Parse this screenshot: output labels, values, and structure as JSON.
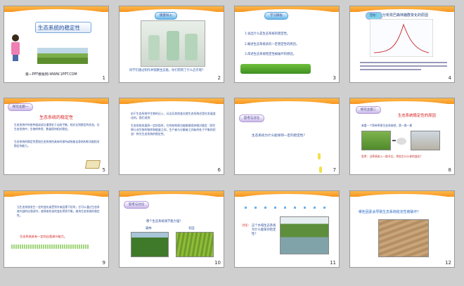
{
  "slides": [
    {
      "num": "1",
      "title": "生态系统的稳定性",
      "footer": "第一PPT模板网-WWW.1PPT.COM"
    },
    {
      "num": "2",
      "badge": "情景导入",
      "question": "同学们通过制作并观察生态瓶，你们得到了什么启示呢？"
    },
    {
      "num": "3",
      "badge": "学习目标",
      "items": [
        "1.说出什么是生态系统的稳定性。",
        "2.概述生态系统具有一定稳定性的原因。",
        "3.简述生态系统稳定性被破坏的原因。"
      ]
    },
    {
      "num": "4",
      "badge": "活动：",
      "title": "分析凯巴森林鹿群变化的原因"
    },
    {
      "num": "5",
      "badge": "探究主题一",
      "heading": "生态系统的稳定性",
      "para": "生态系统中的各种组成成分通常处于动态平衡，相对达到稳定的状态。在生态系统中，生物的种类、数量保持相对稳定。",
      "para2": "生态系统的稳定性是指生态系统所具有的保持或恢复自身结构和功能相对稳定的能力。"
    },
    {
      "num": "6",
      "para": "由于生态系统中生物的迁入、迁出及其他变化使生态系统总是在发展变化的。我们说到：",
      "para2": "生态系统发展到一定阶段时，它的结构和功能能够保持相对稳定（即生物与非生物的物质和能量之间，生产者与分解者之间始终处于平衡的状态）称为生态系统的稳定性。"
    },
    {
      "num": "7",
      "badge": "思考与讨论",
      "question": "生态系统为什么能保持一定的稳定性？"
    },
    {
      "num": "8",
      "badge": "探究主题二",
      "heading": "生态系统稳定性的原因",
      "sub": "来看一个简单草原生态系统吧，第一换一换",
      "note": "思考：当草原进入一群羊后，将发生什么样的变化？"
    },
    {
      "num": "9",
      "para": "当生态系统发生一定的变化或受到外来因素干扰时，它可以通过生态系统内部的自我调节，使原来状态的变化得到平衡，维持生态系统的稳定性。",
      "highlight": "生态系统具有一定的自我调节能力。"
    },
    {
      "num": "10",
      "badge": "思考与讨论",
      "question": "哪个生态系统调节能力强？",
      "labels": [
        "森林",
        "农田"
      ]
    },
    {
      "num": "11",
      "q_label": "讨论：",
      "question": "这个水域生态系统为什么能保持稳定性？"
    },
    {
      "num": "12",
      "title": "哪些因素会导致生态系统稳定性被破坏？"
    }
  ]
}
